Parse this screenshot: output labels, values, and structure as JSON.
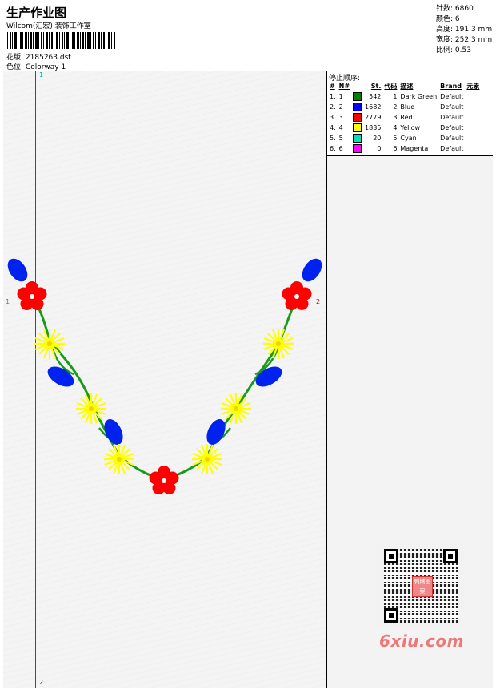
{
  "header": {
    "title": "生产作业图",
    "company": "Wilcom(汇宏) 装饰工作室",
    "design_label": "花版:",
    "design_value": "2185263.dst",
    "colorway_label": "色位:",
    "colorway_value": "Colorway 1"
  },
  "specs": {
    "stitches_label": "针数:",
    "stitches_value": "6860",
    "colors_label": "颜色:",
    "colors_value": "6",
    "height_label": "高度:",
    "height_value": "191.3 mm",
    "width_label": "宽度:",
    "width_value": "252.3 mm",
    "scale_label": "比例:",
    "scale_value": "0.53"
  },
  "stop_sequence": {
    "title": "停止顺序:",
    "headers": [
      "#",
      "N#",
      "St.",
      "代码",
      "描述",
      "Brand",
      "元素"
    ],
    "rows": [
      {
        "idx": "1.",
        "n": "1",
        "color": "#008000",
        "st": "542",
        "code": "1",
        "desc": "Dark Green",
        "brand": "Default"
      },
      {
        "idx": "2.",
        "n": "2",
        "color": "#0000ff",
        "st": "1682",
        "code": "2",
        "desc": "Blue",
        "brand": "Default"
      },
      {
        "idx": "3.",
        "n": "3",
        "color": "#ff0000",
        "st": "2779",
        "code": "3",
        "desc": "Red",
        "brand": "Default"
      },
      {
        "idx": "4.",
        "n": "4",
        "color": "#ffff00",
        "st": "1835",
        "code": "4",
        "desc": "Yellow",
        "brand": "Default"
      },
      {
        "idx": "5.",
        "n": "5",
        "color": "#00e0c0",
        "st": "20",
        "code": "5",
        "desc": "Cyan",
        "brand": "Default"
      },
      {
        "idx": "6.",
        "n": "6",
        "color": "#ff00ff",
        "st": "0",
        "code": "6",
        "desc": "Magenta",
        "brand": "Default"
      }
    ]
  },
  "guides": {
    "v_top": "1",
    "v_bottom": "2",
    "h_left": "1",
    "h_right": "2"
  },
  "watermark": "6xiu.com",
  "seal_text": "刺绣图案",
  "colors": {
    "guide": "#ff0000",
    "vine": "#1a9a1a",
    "leaf": "#0022ee",
    "flower_red": "#ff0000",
    "flower_yellow": "#ffff00"
  },
  "icons": [
    "qr-code-icon",
    "seal-icon",
    "barcode"
  ]
}
